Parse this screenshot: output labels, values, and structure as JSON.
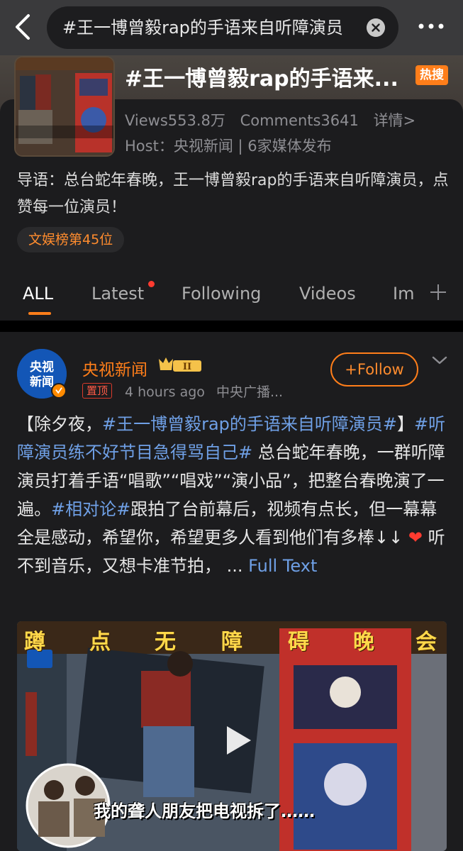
{
  "search": {
    "query": "#王一博曾毅rap的手语来自听障演员"
  },
  "topic": {
    "title": "#王一博曾毅rap的手语来...",
    "hot_badge": "热搜",
    "views": "Views553.8万",
    "comments": "Comments3641",
    "details": "详情>",
    "host": "Host：央视新闻 | 6家媒体发布",
    "intro": "导语：总台蛇年春晚，王一博曾毅rap的手语来自听障演员，点赞每一位演员！",
    "rank": "文娱榜第45位"
  },
  "tabs": [
    {
      "label": "ALL"
    },
    {
      "label": "Latest"
    },
    {
      "label": "Following"
    },
    {
      "label": "Videos"
    },
    {
      "label": "Im"
    }
  ],
  "post": {
    "author": "央视新闻",
    "level_badge": "II",
    "pinned": "置顶",
    "time": "4 hours ago",
    "source": "中央广播...",
    "follow_label": "+Follow",
    "text_parts": {
      "p1": "【除夕夜，",
      "h1": "#王一博曾毅rap的手语来自听障演员#",
      "p2": "】",
      "h2": "#听障演员练不好节目急得骂自己#",
      "p3": " 总台蛇年春晚，一群听障演员打着手语“唱歌”“唱戏”“演小品”，把整台春晚演了一遍。",
      "h3": "#相对论#",
      "p4": "跟拍了台前幕后，视频有点长，但一幕幕全是感动，希望你，希望更多人看到他们有多棒↓↓ ",
      "heart": "❤",
      "p5": " 听不到音乐，又想卡准节拍， ... ",
      "full_text": "Full Text"
    },
    "avatar_text": {
      "line1": "央视",
      "line2": "新闻"
    },
    "video": {
      "banner": [
        "蹲",
        "点",
        "无",
        "障",
        "碍",
        "晚",
        "会"
      ],
      "subtitle": "我的聋人朋友把电视拆了……",
      "cover_caption": "我的聋人朋友把电视拆了……"
    }
  },
  "colors": {
    "accent": "#ff7e1a",
    "link": "#6fa0e6",
    "background": "#1c1c1e"
  }
}
